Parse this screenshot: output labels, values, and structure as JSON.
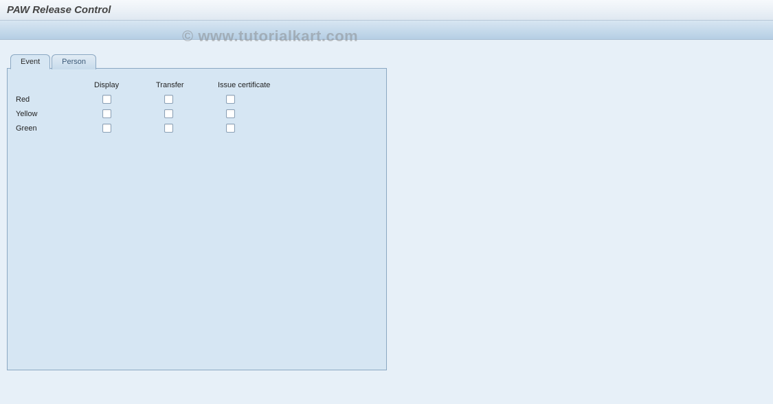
{
  "window": {
    "title": "PAW Release Control"
  },
  "watermark": "© www.tutorialkart.com",
  "tabs": {
    "event": "Event",
    "person": "Person",
    "active": "event"
  },
  "columns": {
    "display": "Display",
    "transfer": "Transfer",
    "issue": "Issue certificate"
  },
  "rows": {
    "red": "Red",
    "yellow": "Yellow",
    "green": "Green"
  }
}
